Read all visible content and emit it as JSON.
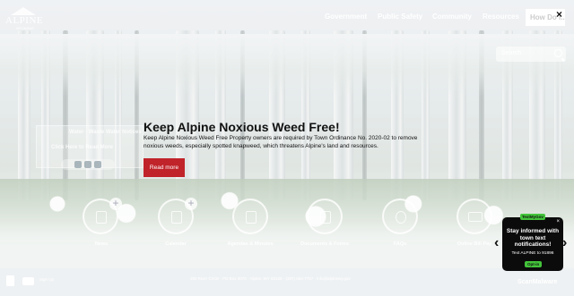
{
  "header": {
    "logo_text": "ALPINE",
    "logo_sub": "WYOMING",
    "nav": [
      {
        "label": "Government"
      },
      {
        "label": "Public Safety"
      },
      {
        "label": "Community"
      },
      {
        "label": "Resources"
      }
    ],
    "how_do_label": "How Do I...",
    "close_label": "×"
  },
  "search": {
    "placeholder": "Search"
  },
  "ghost_card": {
    "title": "Water - Waste Water Notices",
    "link": "Click Here to Read More"
  },
  "slide": {
    "title": "Keep Alpine Noxious Weed Free!",
    "text": "Keep Alpine Noxious Weed Free Property owners are required by Town Ordinance No. 2020-02 to remove noxious weeds, especially spotted knapweed, which threatens Alpine's land and resources.",
    "button_label": "Read more"
  },
  "quick_links": [
    {
      "label": "News",
      "icon": "news-icon"
    },
    {
      "label": "Calendar",
      "icon": "calendar-icon"
    },
    {
      "label": "Agendas & Minutes",
      "icon": "clipboard-icon"
    },
    {
      "label": "Documents & Forms",
      "icon": "documents-icon"
    },
    {
      "label": "FAQs",
      "icon": "question-icon"
    },
    {
      "label": "Online Bill Pay",
      "icon": "credit-card-icon"
    }
  ],
  "footer": {
    "sign_up": "Sign Up",
    "address": "250 River Circle · PO Box 3070 · Alpine, WY 83128 · (307) 654-7757 · info@alpinewy.gov",
    "scan_badge": "ScanMalware"
  },
  "popup": {
    "badge": "TextMyGov",
    "message": "Stay informed with town text notifications!",
    "text": "Text ALPINE to 91896",
    "optin": "Opt-in",
    "close": "×"
  },
  "carousel": {
    "prev": "‹",
    "next": "›"
  }
}
